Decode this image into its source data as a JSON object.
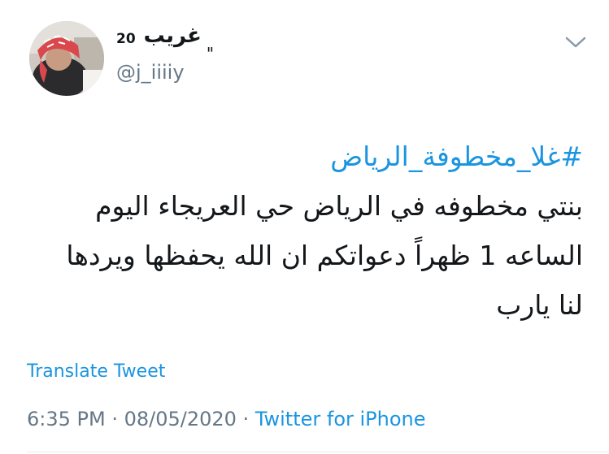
{
  "tweet": {
    "author": {
      "display_name_number": "20",
      "display_name_arabic": "غريب",
      "display_name_mark": "\"",
      "handle": "@j_iiiiy",
      "avatar_icon": "user-avatar-photo"
    },
    "menu_icon": "chevron-down-icon",
    "hashtag": "#غلا_مخطوفة_الرياض",
    "text_lines": [
      "بنتي مخطوفه في الرياض حي العريجاء اليوم",
      "الساعه 1 ظهراً دعواتكم ان الله يحفظها ويردها",
      "لنا يارب"
    ],
    "translate_label": "Translate Tweet",
    "time": "6:35 PM",
    "separator": " · ",
    "date": "08/05/2020",
    "source": "Twitter for iPhone"
  },
  "colors": {
    "link": "#1b95e0",
    "text": "#14171a",
    "secondary": "#657786",
    "divider": "#e6ecf0"
  }
}
